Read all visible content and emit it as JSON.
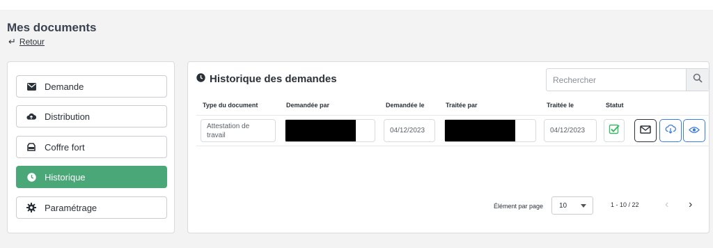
{
  "page": {
    "title": "Mes documents",
    "back_label": "Retour"
  },
  "sidebar": {
    "items": [
      {
        "label": "Demande",
        "icon": "envelope-icon"
      },
      {
        "label": "Distribution",
        "icon": "cloud-upload-icon"
      },
      {
        "label": "Coffre fort",
        "icon": "safe-icon"
      },
      {
        "label": "Historique",
        "icon": "clock-icon",
        "active": true
      },
      {
        "label": "Paramétrage",
        "icon": "gear-icon"
      }
    ],
    "active_color": "#4aa777"
  },
  "main": {
    "title": "Historique des demandes",
    "search": {
      "placeholder": "Rechercher",
      "value": ""
    },
    "table": {
      "headers": {
        "type": "Type du document",
        "requested_by": "Demandée par",
        "requested_on": "Demandée le",
        "processed_by": "Traitée par",
        "processed_on": "Traitée le",
        "status": "Statut"
      },
      "rows": [
        {
          "type": "Attestation de travail",
          "requested_by": "[redacted]",
          "requested_on": "04/12/2023",
          "processed_by": "[redacted]",
          "processed_on": "04/12/2023",
          "status": "checked"
        }
      ]
    },
    "pagination": {
      "per_page_label": "Élément par page",
      "per_page_value": "10",
      "range": "1 - 10 / 22"
    }
  },
  "colors": {
    "accent_green": "#4aa777",
    "action_blue": "#3b7ddd",
    "status_green": "#3cb865"
  }
}
